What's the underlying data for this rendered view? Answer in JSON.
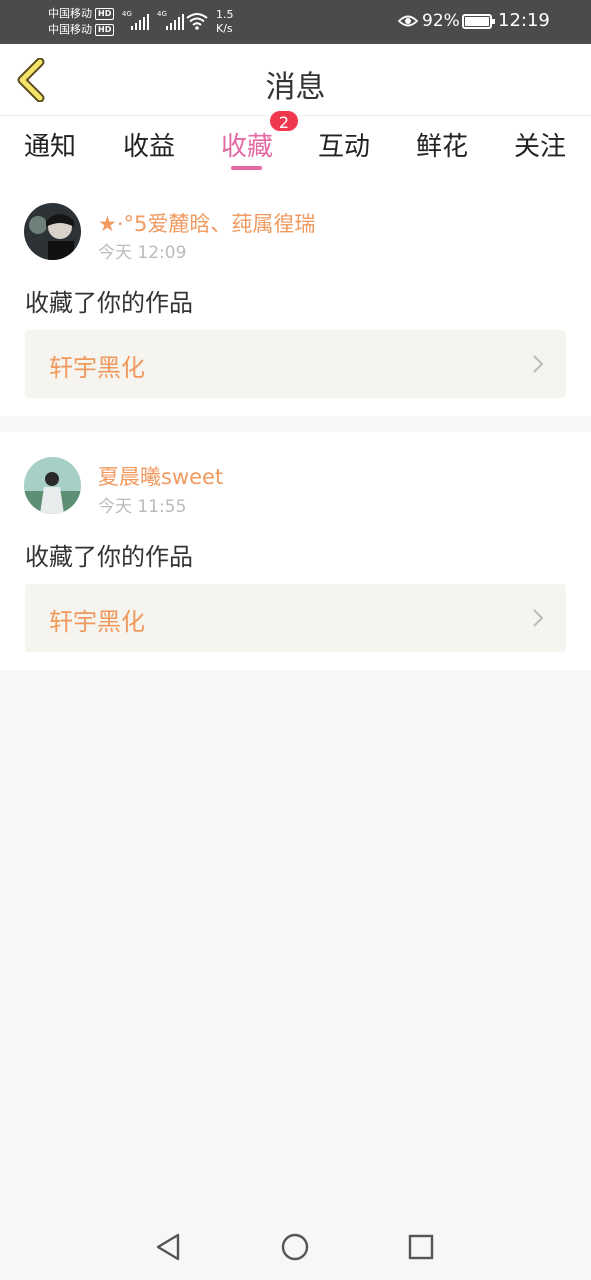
{
  "status_bar": {
    "carrier1": "中国移动",
    "carrier2": "中国移动",
    "hd": "HD",
    "network": "4G",
    "speed_value": "1.5",
    "speed_unit": "K/s",
    "battery": "92%",
    "time": "12:19"
  },
  "header": {
    "title": "消息",
    "back_icon": "chevron-left-icon"
  },
  "tabs": [
    {
      "label": "通知",
      "active": false
    },
    {
      "label": "收益",
      "active": false
    },
    {
      "label": "收藏",
      "active": true,
      "badge": "2"
    },
    {
      "label": "互动",
      "active": false
    },
    {
      "label": "鲜花",
      "active": false
    },
    {
      "label": "关注",
      "active": false
    }
  ],
  "messages": [
    {
      "user": "★·°5爱麓晗、莼属徨瑞",
      "time": "今天 12:09",
      "action": "收藏了你的作品",
      "work": "轩宇黑化"
    },
    {
      "user": "夏晨曦sweet",
      "time": "今天 11:55",
      "action": "收藏了你的作品",
      "work": "轩宇黑化"
    }
  ],
  "colors": {
    "accent": "#e46aa3",
    "username": "#f09a60",
    "badge": "#f0384f",
    "back_icon": "#f5e36b"
  },
  "navbar": {
    "icons": [
      "back-triangle-icon",
      "home-circle-icon",
      "recents-square-icon"
    ]
  }
}
